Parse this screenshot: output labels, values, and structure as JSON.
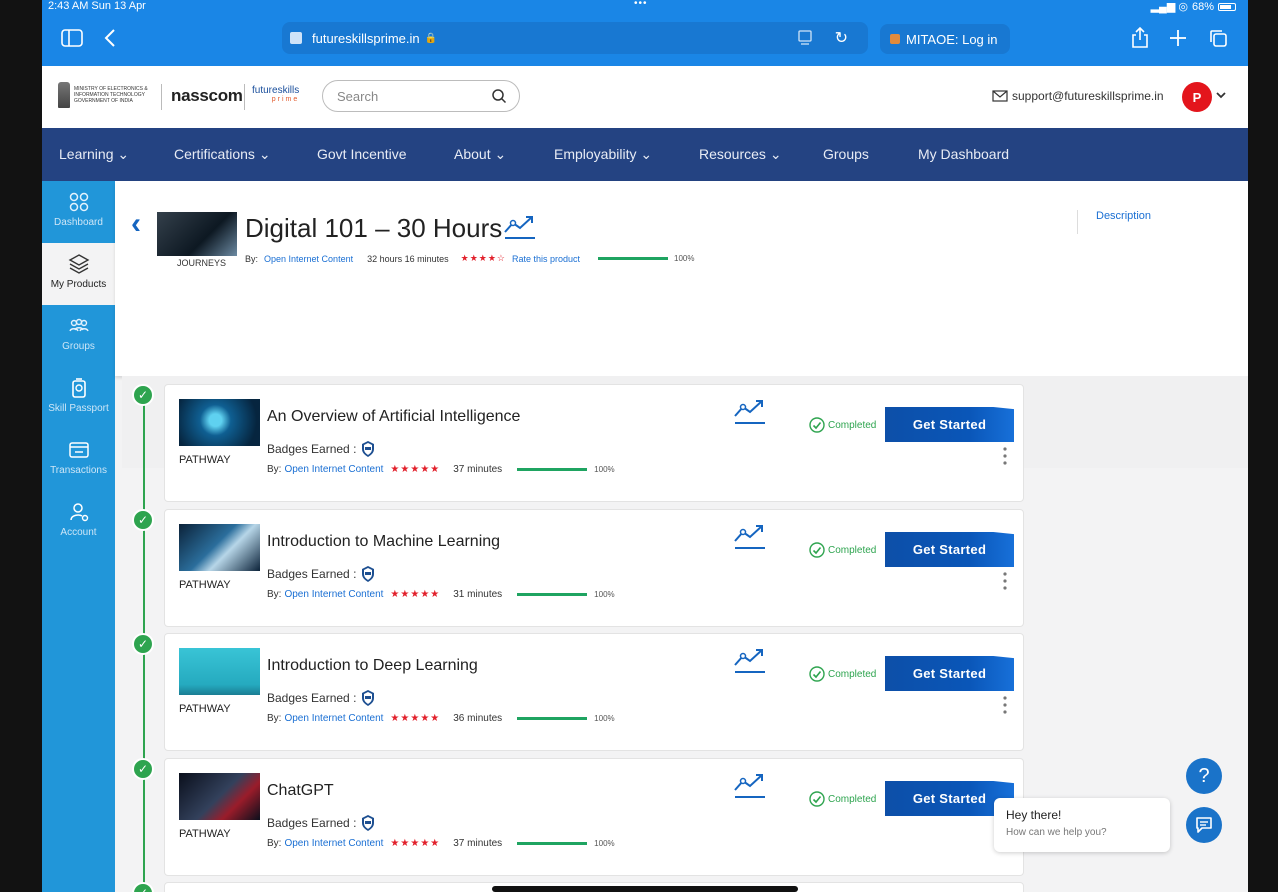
{
  "status_bar": {
    "time": "2:43 AM  Sun 13 Apr",
    "battery": "68%"
  },
  "browser": {
    "url": "futureskillsprime.in",
    "other_tab": "MITAOE: Log in"
  },
  "header": {
    "gov_text": "MINISTRY OF ELECTRONICS & INFORMATION TECHNOLOGY GOVERNMENT OF INDIA",
    "nasscom": "nasscom",
    "fsp_line1": "futureskills",
    "fsp_line2": "prime",
    "search_placeholder": "Search",
    "support_email": "support@futureskillsprime.in",
    "avatar_initial": "P"
  },
  "nav": {
    "items": [
      "Learning",
      "Certifications",
      "Govt Incentive",
      "About",
      "Employability",
      "Resources",
      "Groups",
      "My Dashboard"
    ]
  },
  "sidebar": {
    "items": [
      "Dashboard",
      "My Products",
      "Groups",
      "Skill Passport",
      "Transactions",
      "Account"
    ]
  },
  "product": {
    "title": "Digital 101 – 30 Hours",
    "type": "JOURNEYS",
    "by_label": "By:",
    "provider": "Open Internet Content",
    "duration": "32 hours 16 minutes",
    "rating": 4,
    "rate_label": "Rate this product",
    "progress": "100%",
    "description_tab": "Description"
  },
  "courses": [
    {
      "title": "An Overview of Artificial Intelligence",
      "type": "PATHWAY",
      "badges_label": "Badges Earned :",
      "by_label": "By:",
      "provider": "Open Internet Content",
      "rating": 5,
      "duration": "37 minutes",
      "progress": "100%",
      "status": "Completed",
      "button": "Get Started"
    },
    {
      "title": "Introduction to Machine Learning",
      "type": "PATHWAY",
      "badges_label": "Badges Earned :",
      "by_label": "By:",
      "provider": "Open Internet Content",
      "rating": 5,
      "duration": "31 minutes",
      "progress": "100%",
      "status": "Completed",
      "button": "Get Started"
    },
    {
      "title": "Introduction to Deep Learning",
      "type": "PATHWAY",
      "badges_label": "Badges Earned :",
      "by_label": "By:",
      "provider": "Open Internet Content",
      "rating": 5,
      "duration": "36 minutes",
      "progress": "100%",
      "status": "Completed",
      "button": "Get Started"
    },
    {
      "title": "ChatGPT",
      "type": "PATHWAY",
      "badges_label": "Badges Earned :",
      "by_label": "By:",
      "provider": "Open Internet Content",
      "rating": 5,
      "duration": "37 minutes",
      "progress": "100%",
      "status": "Completed",
      "button": "Get Started"
    }
  ],
  "chat": {
    "help_symbol": "?",
    "greeting": "Hey there!",
    "subtext": "How can we help you?"
  },
  "colors": {
    "browser_bar": "#1a86e6",
    "nav": "#244382",
    "sidebar": "#2196d9",
    "complete_green": "#2ea44f",
    "star_red": "#e2202b",
    "button_blue": "#0a56b8"
  }
}
